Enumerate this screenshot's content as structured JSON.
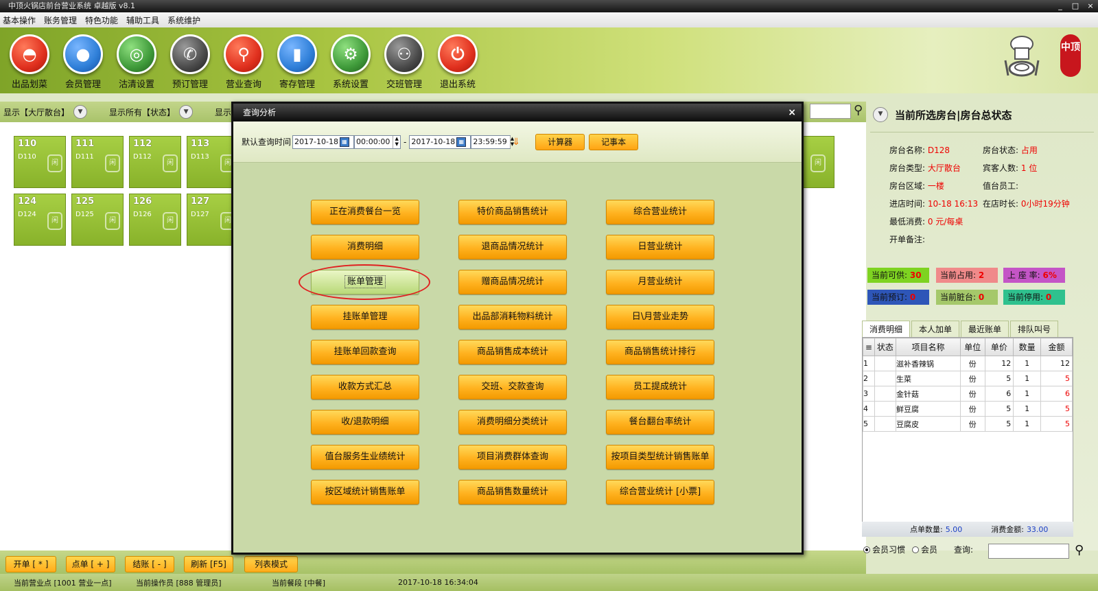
{
  "window": {
    "title": "中顶火锅店前台营业系统 卓越版 v8.1",
    "controls": [
      "_",
      "□",
      "×"
    ]
  },
  "menu": [
    "基本操作",
    "账务管理",
    "特色功能",
    "辅助工具",
    "系统维护"
  ],
  "toolbar": [
    {
      "label": "出品划菜",
      "icon": "cloche-icon",
      "color": "#e0301e"
    },
    {
      "label": "会员管理",
      "icon": "member-icon",
      "color": "#2f7fd8"
    },
    {
      "label": "沽清设置",
      "icon": "plate-icon",
      "color": "#3f9a3a"
    },
    {
      "label": "预订管理",
      "icon": "phone-icon",
      "color": "#4a4a4a"
    },
    {
      "label": "营业查询",
      "icon": "magnifier-icon",
      "color": "#e0301e"
    },
    {
      "label": "寄存管理",
      "icon": "bag-icon",
      "color": "#2f7fd8"
    },
    {
      "label": "系统设置",
      "icon": "gear-icon",
      "color": "#3f9a3a"
    },
    {
      "label": "交班管理",
      "icon": "handover-icon",
      "color": "#4a4a4a"
    },
    {
      "label": "退出系统",
      "icon": "power-icon",
      "color": "#e0301e"
    }
  ],
  "logo": {
    "seal_text": "中顶"
  },
  "filters": {
    "area": "显示【大厅散台】",
    "status": "显示所有【状态】",
    "third": "显示"
  },
  "tables": [
    {
      "no": "110",
      "code": "D110"
    },
    {
      "no": "111",
      "code": "D111"
    },
    {
      "no": "112",
      "code": "D112"
    },
    {
      "no": "113",
      "code": "D113"
    },
    {
      "no": "124",
      "code": "D124"
    },
    {
      "no": "125",
      "code": "D125"
    },
    {
      "no": "126",
      "code": "D126"
    },
    {
      "no": "127",
      "code": "D127"
    }
  ],
  "bottom_buttons": [
    "开单 [ * ]",
    "点单 [ + ]",
    "结账 [ - ]",
    "刷新 [F5]",
    "列表模式"
  ],
  "status": {
    "point": "当前营业点 [1001 营业一点]",
    "operator": "当前操作员 [888 管理员]",
    "meal": "当前餐段 [中餐]",
    "datetime": "2017-10-18 16:34:04"
  },
  "right_panel": {
    "title": "当前所选房台|房台总状态",
    "info": [
      {
        "label": "房台名称:",
        "value": "D128"
      },
      {
        "label": "房台状态:",
        "value": "占用"
      },
      {
        "label": "房台类型:",
        "value": "大厅散台"
      },
      {
        "label": "宾客人数:",
        "value": "1 位"
      },
      {
        "label": "房台区域:",
        "value": "一楼"
      },
      {
        "label": "值台员工:",
        "value": ""
      },
      {
        "label": "进店时间:",
        "value": "10-18 16:13"
      },
      {
        "label": "在店时长:",
        "value": "0小时19分钟"
      },
      {
        "label": "最低消费:",
        "value": "0 元/每桌"
      },
      {
        "label": "开单备注:",
        "value": ""
      }
    ],
    "stats": [
      {
        "label": "当前可供:",
        "value": "30",
        "bg": "#7ed321"
      },
      {
        "label": "当前占用:",
        "value": "2",
        "bg": "#f08a8a"
      },
      {
        "label": "上 座 率:",
        "value": "6%",
        "bg": "#c455c6"
      },
      {
        "label": "当前预订:",
        "value": "0",
        "bg": "#2e56b8"
      },
      {
        "label": "当前脏台:",
        "value": "0",
        "bg": "#a5c86a"
      },
      {
        "label": "当前停用:",
        "value": "0",
        "bg": "#2fc18e"
      }
    ],
    "tabs": [
      "消费明细",
      "本人加单",
      "最近账单",
      "排队叫号"
    ],
    "grid_headers": [
      "状态",
      "项目名称",
      "单位",
      "单价",
      "数量",
      "金额"
    ],
    "grid_rows": [
      {
        "idx": "1",
        "name": "滋补香辣锅",
        "unit": "份",
        "price": "12",
        "qty": "1",
        "amount": "12"
      },
      {
        "idx": "2",
        "name": "生菜",
        "unit": "份",
        "price": "5",
        "qty": "1",
        "amount": "5"
      },
      {
        "idx": "3",
        "name": "金针菇",
        "unit": "份",
        "price": "6",
        "qty": "1",
        "amount": "6"
      },
      {
        "idx": "4",
        "name": "鲜豆腐",
        "unit": "份",
        "price": "5",
        "qty": "1",
        "amount": "5"
      },
      {
        "idx": "5",
        "name": "豆腐皮",
        "unit": "份",
        "price": "5",
        "qty": "1",
        "amount": "5"
      }
    ],
    "footer": {
      "count_label": "点单数量:",
      "count": "5.00",
      "amount_label": "消费金额:",
      "amount": "33.00"
    },
    "member": {
      "opt1": "会员习惯",
      "opt2": "会员",
      "query": "查询:"
    }
  },
  "dialog": {
    "title": "查询分析",
    "close": "×",
    "query_label": "默认查询时间",
    "date_from": "2017-10-18",
    "time_from": "00:00:00",
    "sep": "-",
    "date_to": "2017-10-18",
    "time_to": "23:59:59",
    "calc": "计算器",
    "notepad": "记事本",
    "buttons": [
      [
        "正在消费餐台一览",
        "特价商品销售统计",
        "综合营业统计"
      ],
      [
        "消费明细",
        "退商品情况统计",
        "日营业统计"
      ],
      [
        "账单管理",
        "赠商品情况统计",
        "月营业统计"
      ],
      [
        "挂账单管理",
        "出品部消耗物料统计",
        "日\\月营业走势"
      ],
      [
        "挂账单回款查询",
        "商品销售成本统计",
        "商品销售统计排行"
      ],
      [
        "收款方式汇总",
        "交班、交款查询",
        "员工提成统计"
      ],
      [
        "收/退款明细",
        "消费明细分类统计",
        "餐台翻台率统计"
      ],
      [
        "值台服务生业绩统计",
        "项目消费群体查询",
        "按项目类型统计销售账单"
      ],
      [
        "按区域统计销售账单",
        "商品销售数量统计",
        "综合营业统计 [小票]"
      ]
    ],
    "selected": "账单管理"
  }
}
